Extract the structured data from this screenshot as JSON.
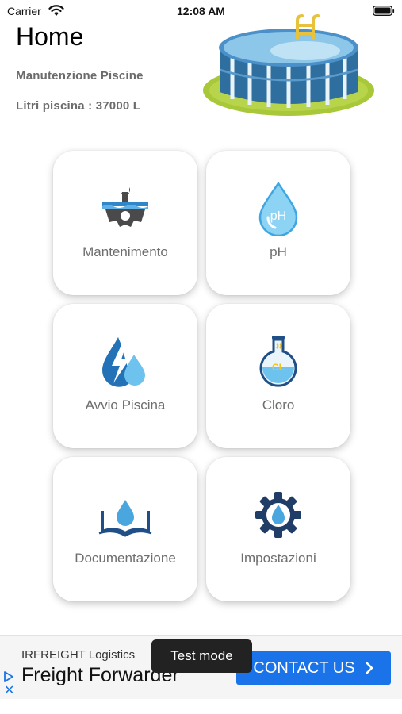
{
  "status_bar": {
    "carrier": "Carrier",
    "time": "12:08 AM",
    "wifi_icon": "wifi-icon",
    "battery_icon": "battery-icon"
  },
  "header": {
    "title": "Home",
    "subtitle": "Manutenzione Piscine",
    "pool_liters": "Litri piscina : 37000 L",
    "illustration": "pool-illustration"
  },
  "menu": [
    {
      "label": "Mantenimento",
      "icon": "pool-maintenance-icon"
    },
    {
      "label": "pH",
      "icon": "ph-drop-icon"
    },
    {
      "label": "Avvio Piscina",
      "icon": "water-energy-icon"
    },
    {
      "label": "Cloro",
      "icon": "chlorine-flask-icon"
    },
    {
      "label": "Documentazione",
      "icon": "book-drop-icon"
    },
    {
      "label": "Impostazioni",
      "icon": "gear-drop-icon"
    }
  ],
  "ad": {
    "brand": "IRFREIGHT Logistics",
    "headline": "Freight Forwarder",
    "cta": "CONTACT US",
    "test_mode": "Test mode",
    "close": "✕"
  },
  "colors": {
    "accent_blue": "#1a73e8",
    "pool_blue": "#3a88c0",
    "grass_green": "#a8c83a",
    "icon_dark_blue": "#1f4f86",
    "icon_light_blue": "#6ec3ee"
  },
  "icon_text": {
    "ph": "pH",
    "chlorine": "CL"
  }
}
